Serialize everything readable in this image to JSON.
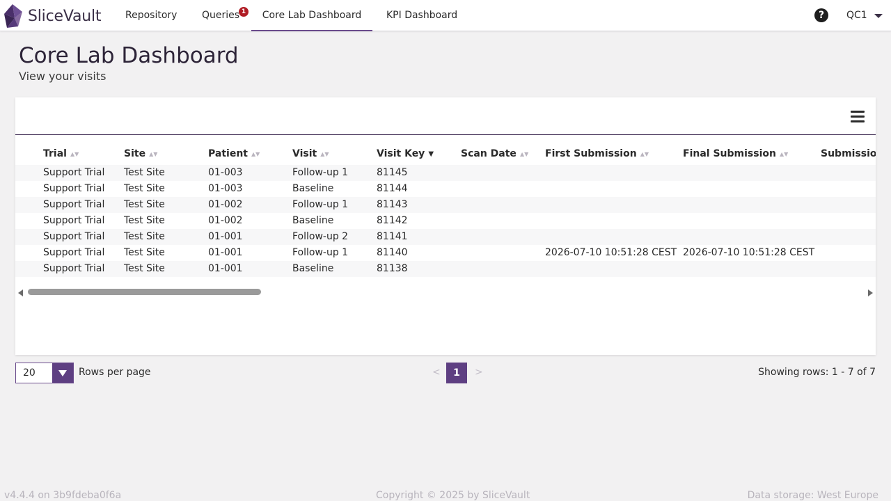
{
  "app": {
    "name": "SliceVault"
  },
  "nav": {
    "items": [
      {
        "label": "Repository"
      },
      {
        "label": "Queries",
        "badge": "1"
      },
      {
        "label": "Core Lab Dashboard",
        "active": true
      },
      {
        "label": "KPI Dashboard"
      }
    ],
    "help_icon": "question-circle-icon",
    "user": "QC1"
  },
  "page": {
    "title": "Core Lab Dashboard",
    "subtitle": "View your visits"
  },
  "table": {
    "columns": [
      {
        "label": "Trial",
        "sort": "none"
      },
      {
        "label": "Site",
        "sort": "none"
      },
      {
        "label": "Patient",
        "sort": "none"
      },
      {
        "label": "Visit",
        "sort": "none"
      },
      {
        "label": "Visit Key",
        "sort": "desc"
      },
      {
        "label": "Scan Date",
        "sort": "none"
      },
      {
        "label": "First Submission",
        "sort": "none"
      },
      {
        "label": "Final Submission",
        "sort": "none"
      },
      {
        "label": "Submission",
        "sort": "none"
      }
    ],
    "rows": [
      [
        "Support Trial",
        "Test Site",
        "01-003",
        "Follow-up 1",
        "81145",
        "",
        "",
        "",
        ""
      ],
      [
        "Support Trial",
        "Test Site",
        "01-003",
        "Baseline",
        "81144",
        "",
        "",
        "",
        ""
      ],
      [
        "Support Trial",
        "Test Site",
        "01-002",
        "Follow-up 1",
        "81143",
        "",
        "",
        "",
        ""
      ],
      [
        "Support Trial",
        "Test Site",
        "01-002",
        "Baseline",
        "81142",
        "",
        "",
        "",
        ""
      ],
      [
        "Support Trial",
        "Test Site",
        "01-001",
        "Follow-up 2",
        "81141",
        "",
        "",
        "",
        ""
      ],
      [
        "Support Trial",
        "Test Site",
        "01-001",
        "Follow-up 1",
        "81140",
        "",
        "2026-07-10 10:51:28 CEST",
        "2026-07-10 10:51:28 CEST",
        ""
      ],
      [
        "Support Trial",
        "Test Site",
        "01-001",
        "Baseline",
        "81138",
        "",
        "",
        "",
        ""
      ]
    ]
  },
  "pagination": {
    "rows_per_page": "20",
    "rows_per_page_label": "Rows per page",
    "prev": "<",
    "current_page": "1",
    "next": ">",
    "showing": "Showing rows: 1 - 7 of 7"
  },
  "footer": {
    "version": "v4.4.4 on 3b9fdeba0f6a",
    "copyright": "Copyright © 2025 by SliceVault",
    "storage": "Data storage: West Europe"
  },
  "colors": {
    "accent": "#5e3f82",
    "badge": "#b01c24"
  }
}
